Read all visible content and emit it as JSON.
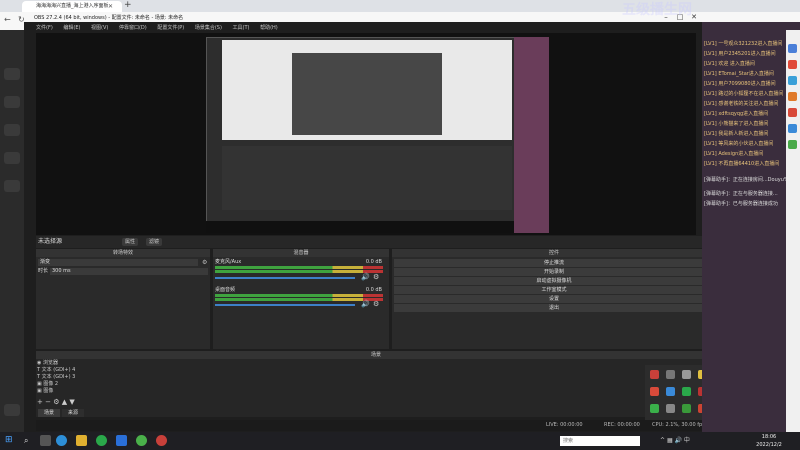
{
  "browser": {
    "tab_title": "海海海海兴直播_海上港入序面板",
    "obs_title": "OBS 27.2.4 (64 bit, windows) - 配置文件: 未命名 - 场景: 未命名"
  },
  "obs": {
    "menu": [
      "文件(F)",
      "编辑(E)",
      "视图(V)",
      "停靠窗口(D)",
      "配置文件(P)",
      "场景集合(S)",
      "工具(T)",
      "帮助(H)"
    ],
    "source_toolbar": {
      "label": "未选择源",
      "props": "属性",
      "filters": "滤镜"
    },
    "transitions": {
      "header": "转场特效",
      "effect": "渐变",
      "duration_label": "时长",
      "duration_value": "300 ms"
    },
    "mixer": {
      "header": "混音器",
      "tracks": [
        {
          "name": "麦克风/Aux",
          "db": "0.0 dB"
        },
        {
          "name": "桌面音频",
          "db": "0.0 dB"
        }
      ]
    },
    "controls": {
      "header": "控件",
      "buttons": [
        "停止推流",
        "开始录制",
        "启动虚拟摄像机",
        "工作室模式",
        "设置",
        "退出"
      ]
    },
    "scenes_header": "场景",
    "sources": [
      {
        "icon": "browser-icon",
        "label": "浏览器"
      },
      {
        "icon": "text-icon",
        "label": "文本 (GDI+) 4"
      },
      {
        "icon": "text-icon",
        "label": "文本 (GDI+) 3"
      },
      {
        "icon": "image-icon",
        "label": "图像 2"
      },
      {
        "icon": "image-icon",
        "label": "图像"
      }
    ],
    "bottom_tabs": [
      "场景",
      "来源"
    ],
    "status": {
      "live": "LIVE: 00:00:00",
      "rec": "REC: 00:00:00",
      "cpu": "CPU: 2.1%, 30.00 fps"
    }
  },
  "chat": {
    "watermark": "五级播生网",
    "lines": [
      "[LV1] 一号观众321232进入直播间",
      "[LV1] 用户2345201进入直播间",
      "[LV1] 欢迎 进入直播间",
      "[LV1] ETomai_Star进入直播间",
      "[LV1] 用户7099080进入直播间",
      "[LV1] 路过的小狐狸不在进入直播间",
      "[LV1] 感谢老铁的关注进入直播间",
      "[LV1] xdftsqyqg进入直播间",
      "[LV1] 小熊猫来了进入直播间",
      "[LV1] 我是新人新进入直播间",
      "[LV1] 等风来的小伙进入直播间",
      "[LV1] Adesign进入直播间",
      "[LV1] 不再直播64410进入直播间"
    ],
    "system": [
      "[弹幕助手]：正在连接房间...Douyu%224019",
      "[弹幕助手]：正在与服务器连接...",
      "[弹幕助手]：已与服务器连接成功"
    ]
  },
  "taskbar": {
    "time": "18:06",
    "date": "2022/12/2",
    "search_placeholder": "搜索"
  },
  "colors": {
    "accent": "#3d80c8",
    "meter_green": "#3fa33f",
    "chat_gold": "#e7c27a"
  }
}
